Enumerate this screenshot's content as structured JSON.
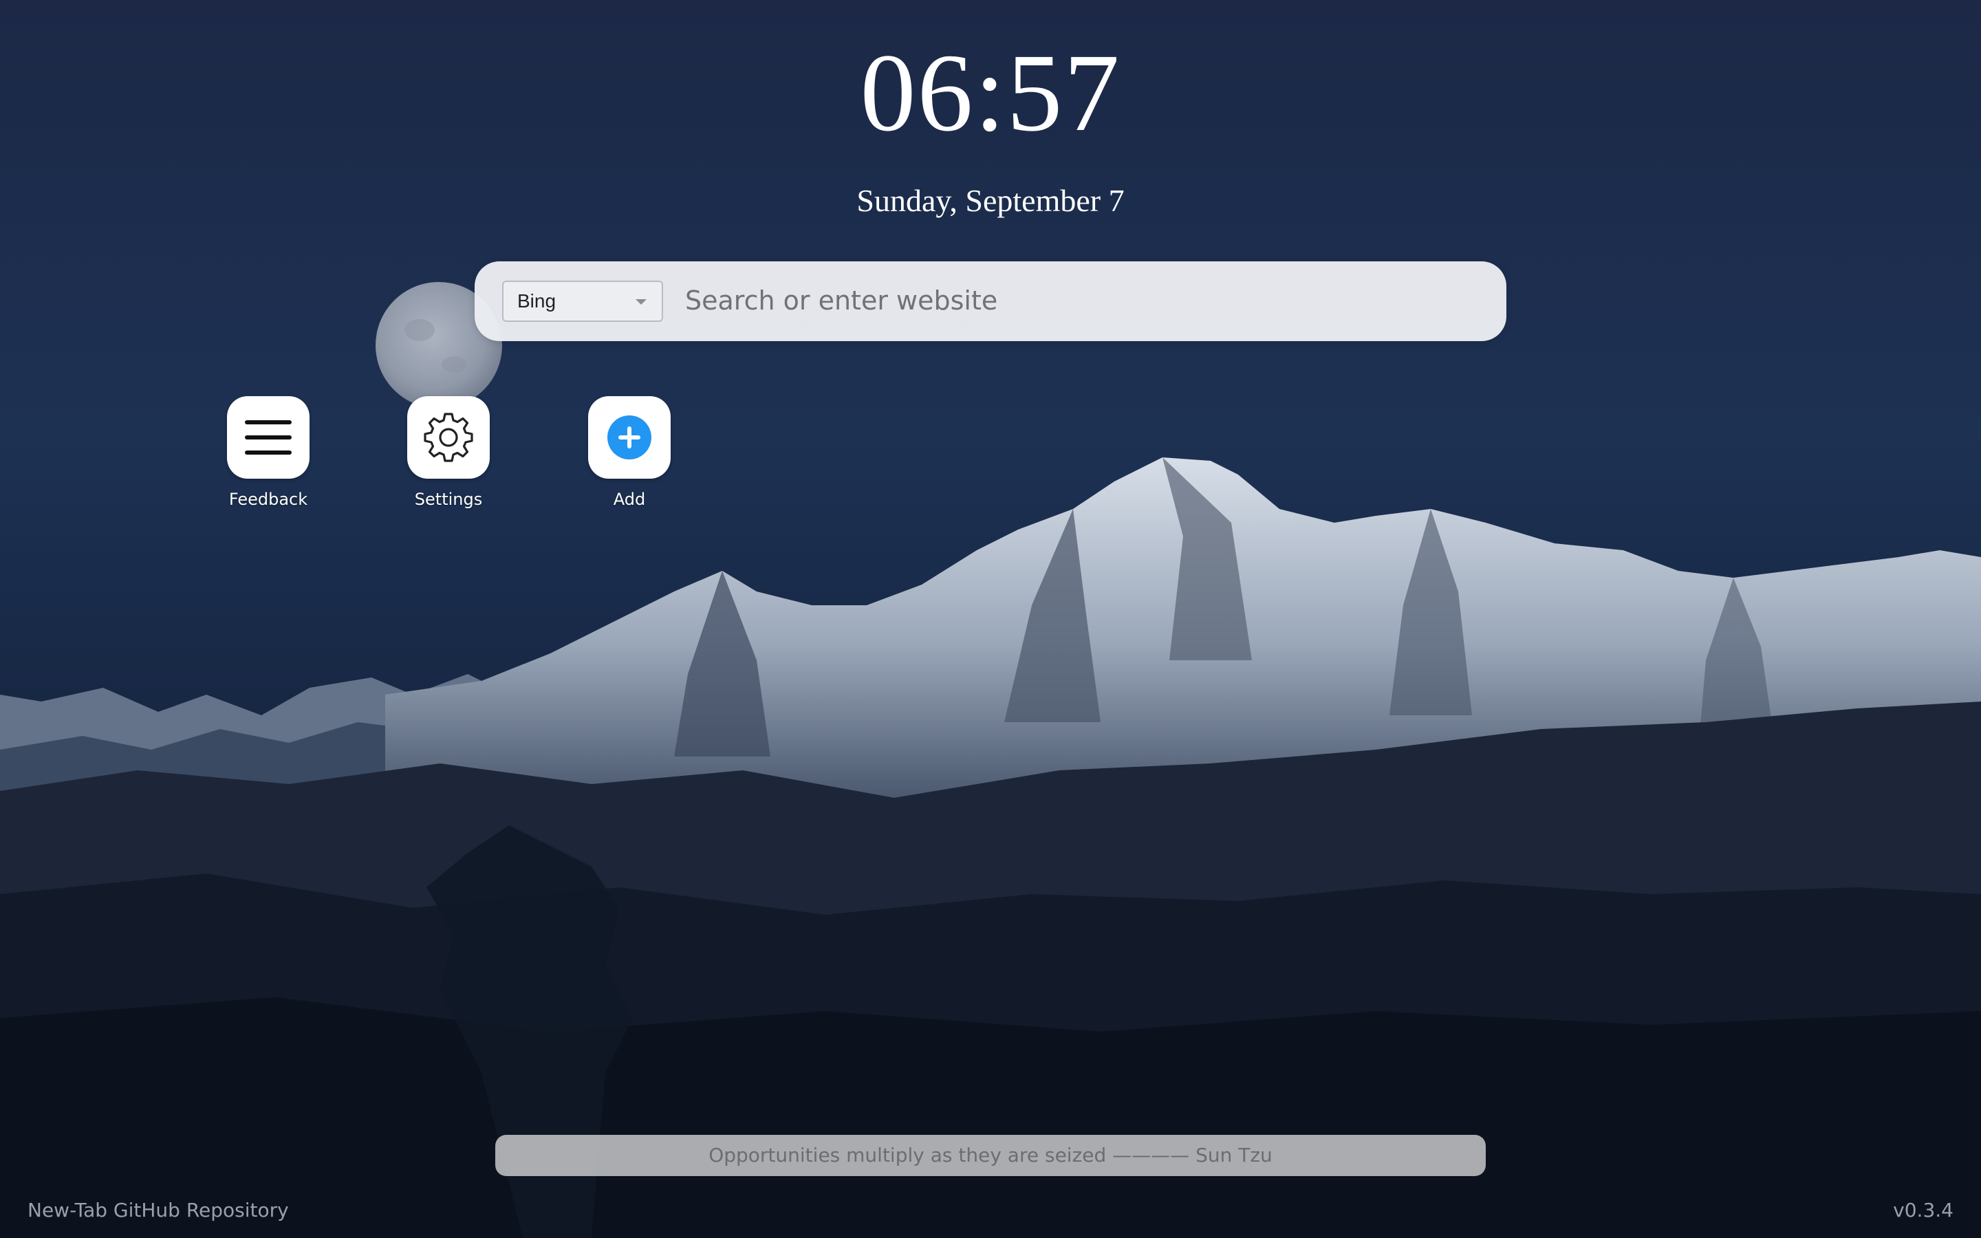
{
  "clock": {
    "time": "06:57",
    "date": "Sunday, September 7"
  },
  "search": {
    "engine": "Bing",
    "placeholder": "Search or enter website"
  },
  "shortcuts": [
    {
      "label": "Feedback",
      "icon": "menu-icon"
    },
    {
      "label": "Settings",
      "icon": "gear-icon"
    },
    {
      "label": "Add",
      "icon": "plus-circle-icon"
    }
  ],
  "quote": {
    "text": "Opportunities multiply as they are seized ———— Sun Tzu"
  },
  "footer": {
    "repo_link": "New-Tab GitHub Repository",
    "version": "v0.3.4"
  },
  "colors": {
    "sky_top": "#1b2847",
    "sky_mid": "#1f3356",
    "snow": "#c9d3e0",
    "accent_blue": "#2196f3"
  }
}
